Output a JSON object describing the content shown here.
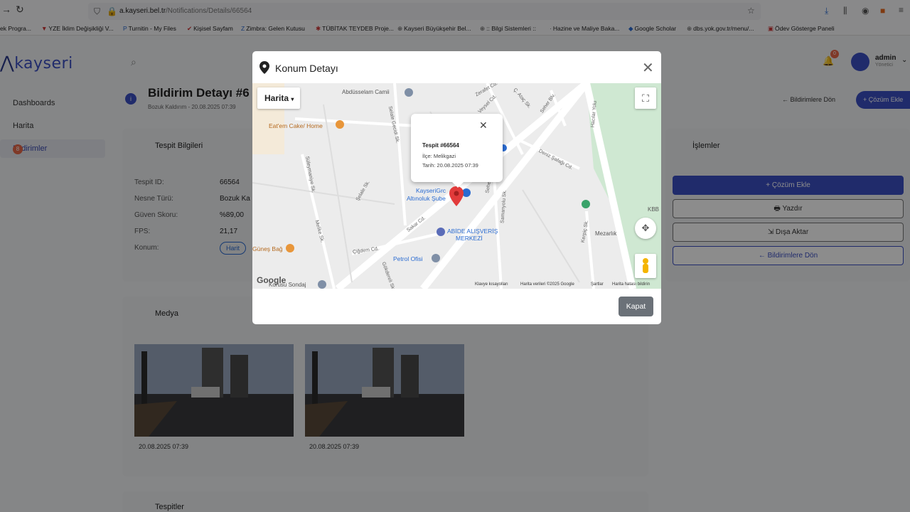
{
  "browser": {
    "url_host": "a.kayseri.bel.tr",
    "url_path": "/Notifications/Details/66564",
    "bookmarks": [
      "ek Progra...",
      "YZE İklim Değişikliği V...",
      "Turnitin - My Files",
      "Kişisel Sayfam",
      "Zimbra: Gelen Kutusu",
      "TÜBİTAK TEYDEB Proje...",
      "Kayseri Büyükşehir Bel...",
      ":: Bilgi Sistemleri ::",
      "Hazine ve Maliye Baka...",
      "Google Scholar",
      "dbs.yok.gov.tr/menu/...",
      "Ödev Gösterge Paneli"
    ]
  },
  "app": {
    "logo": "kayseri",
    "user": {
      "name": "admin",
      "role": "Yönetici",
      "notif_count": "0"
    },
    "sidebar": [
      {
        "label": "Dashboards"
      },
      {
        "label": "Harita"
      },
      {
        "label": "Bildirimler",
        "badge": "8"
      }
    ],
    "page": {
      "title": "Bildirim Detayı #6",
      "subtitle": "Bozuk Kaldırım - 20.08.2025 07:39",
      "back_label": "Bildirimlere Dön",
      "add_label": "Çözüm Ekle"
    },
    "tespit": {
      "title": "Tespit Bilgileri",
      "rows": [
        {
          "label": "Tespit ID:",
          "value": "66564"
        },
        {
          "label": "Nesne Türü:",
          "value": "Bozuk Ka"
        },
        {
          "label": "Güven Skoru:",
          "value": "%89,00"
        },
        {
          "label": "FPS:",
          "value": "21,17"
        },
        {
          "label": "Konum:",
          "value": "Harit"
        }
      ]
    },
    "islemler": {
      "title": "İşlemler",
      "buttons": [
        "Çözüm Ekle",
        "Yazdır",
        "Dışa Aktar",
        "Bildirimlere Dön"
      ]
    },
    "medya": {
      "title": "Medya",
      "items": [
        {
          "date": "20.08.2025 07:39"
        },
        {
          "date": "20.08.2025 07:39"
        }
      ]
    },
    "tespitler": {
      "title": "Tespitler"
    }
  },
  "modal": {
    "title": "Konum Detayı",
    "map_type": "Harita",
    "popup": {
      "title": "Tespit #66564",
      "ilce": "İlçe: Melikgazi",
      "tarih": "Tarih: 20.08.2025 07:39"
    },
    "labels": [
      "Abdüsselam Camii",
      "Eat'em Cake/ Home",
      "KayseriGrc",
      "Altınoluk Şube",
      "ABİDE ALIŞVERİŞ",
      "MERKEZİ",
      "Petrol Ofisi",
      "Mezarlık",
      "Güneş Bağ",
      "Korusu Sondaj",
      "KBB",
      "Deniz Şafağı Cd.",
      "Hacılar Yolu",
      "Sakar Cd.",
      "Çiğdem Cd.",
      "Seher Sk.",
      "Samanyolu Sk.",
      "Melike Sk.",
      "Süleymaniye Sk.",
      "Şelale Sk.",
      "Selale Gecidi Sk.",
      "Zerafet Cd.",
      "Veysel Cd.",
      "Gökdereli Sk.",
      "Kerpiç Sk.",
      "Seher Blv.",
      "Ç. Ataç Sk."
    ],
    "footer": [
      "Klavye kısayolları",
      "Harita verileri ©2025 Google",
      "Şartlar",
      "Harita hatası bildirin"
    ],
    "google": "Google",
    "close_label": "Kapat"
  }
}
